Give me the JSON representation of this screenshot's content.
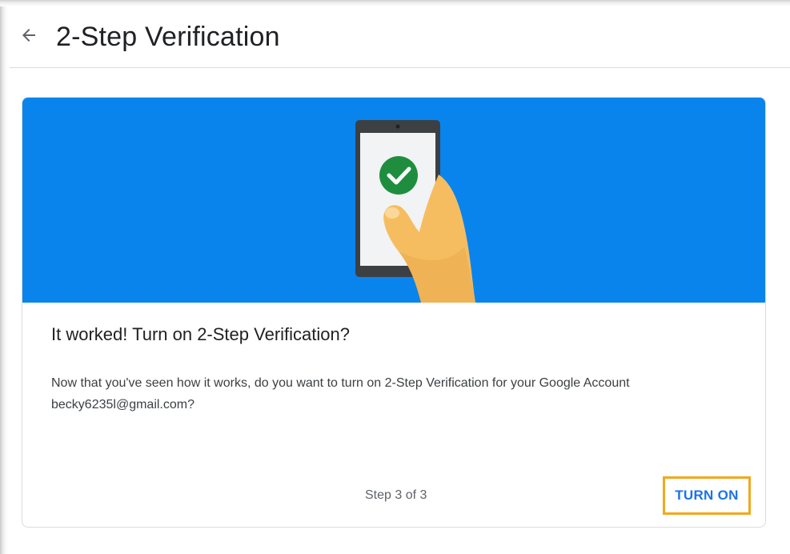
{
  "header": {
    "title": "2-Step Verification",
    "back_icon": "arrow-left-icon"
  },
  "card": {
    "banner_color": "#0a84ed",
    "illustration_icon": "phone-checkmark-icon",
    "title": "It worked! Turn on 2-Step Verification?",
    "body": "Now that you've seen how it works, do you want to turn on 2-Step Verification for your Google Account becky6235l@gmail.com?",
    "step": "Step 3 of 3",
    "primary_button": "TURN ON",
    "accent_color": "#1a73e8",
    "highlight_color": "#f2a81d"
  }
}
